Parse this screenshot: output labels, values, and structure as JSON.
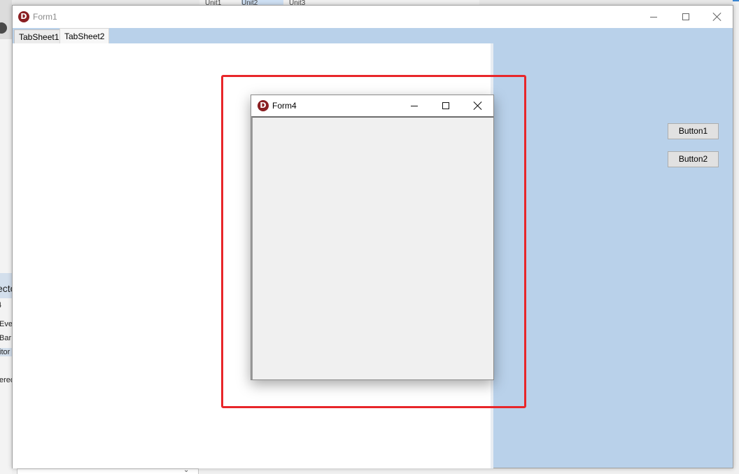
{
  "colors": {
    "form_background": "#b9d1ea",
    "app_icon": "#8a1f22",
    "highlight_border": "#e8262a",
    "button_face": "#e1e1e1",
    "client_area": "#f0f0f0"
  },
  "background_ide": {
    "top_tabs": [
      "Unit1",
      "Unit2",
      "Unit3"
    ],
    "left_fragments": [
      "ecto",
      "4",
      "Eve",
      "Bar",
      "itor",
      "ered"
    ]
  },
  "form1": {
    "title": "Form1",
    "app_icon_letter": "D",
    "tabs": [
      {
        "label": "TabSheet1",
        "active": false
      },
      {
        "label": "TabSheet2",
        "active": true
      }
    ],
    "buttons": {
      "button1": "Button1",
      "button2": "Button2"
    }
  },
  "form4": {
    "title": "Form4",
    "app_icon_letter": "D"
  }
}
